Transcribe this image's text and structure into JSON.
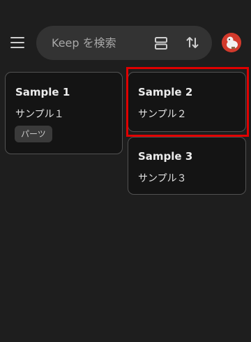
{
  "header": {
    "search_placeholder": "Keep を検索",
    "menu_icon": "menu-icon",
    "view_icon": "list-view-icon",
    "sort_icon": "sort-icon"
  },
  "notes": [
    {
      "title": "Sample 1",
      "body": "サンプル１",
      "label": "パーツ"
    },
    {
      "title": "Sample 2",
      "body": "サンプル２"
    },
    {
      "title": "Sample 3",
      "body": "サンプル３"
    }
  ],
  "colors": {
    "background": "#1e1e1e",
    "card": "#141414",
    "highlight": "#e00000",
    "avatar": "#d23a2c"
  }
}
